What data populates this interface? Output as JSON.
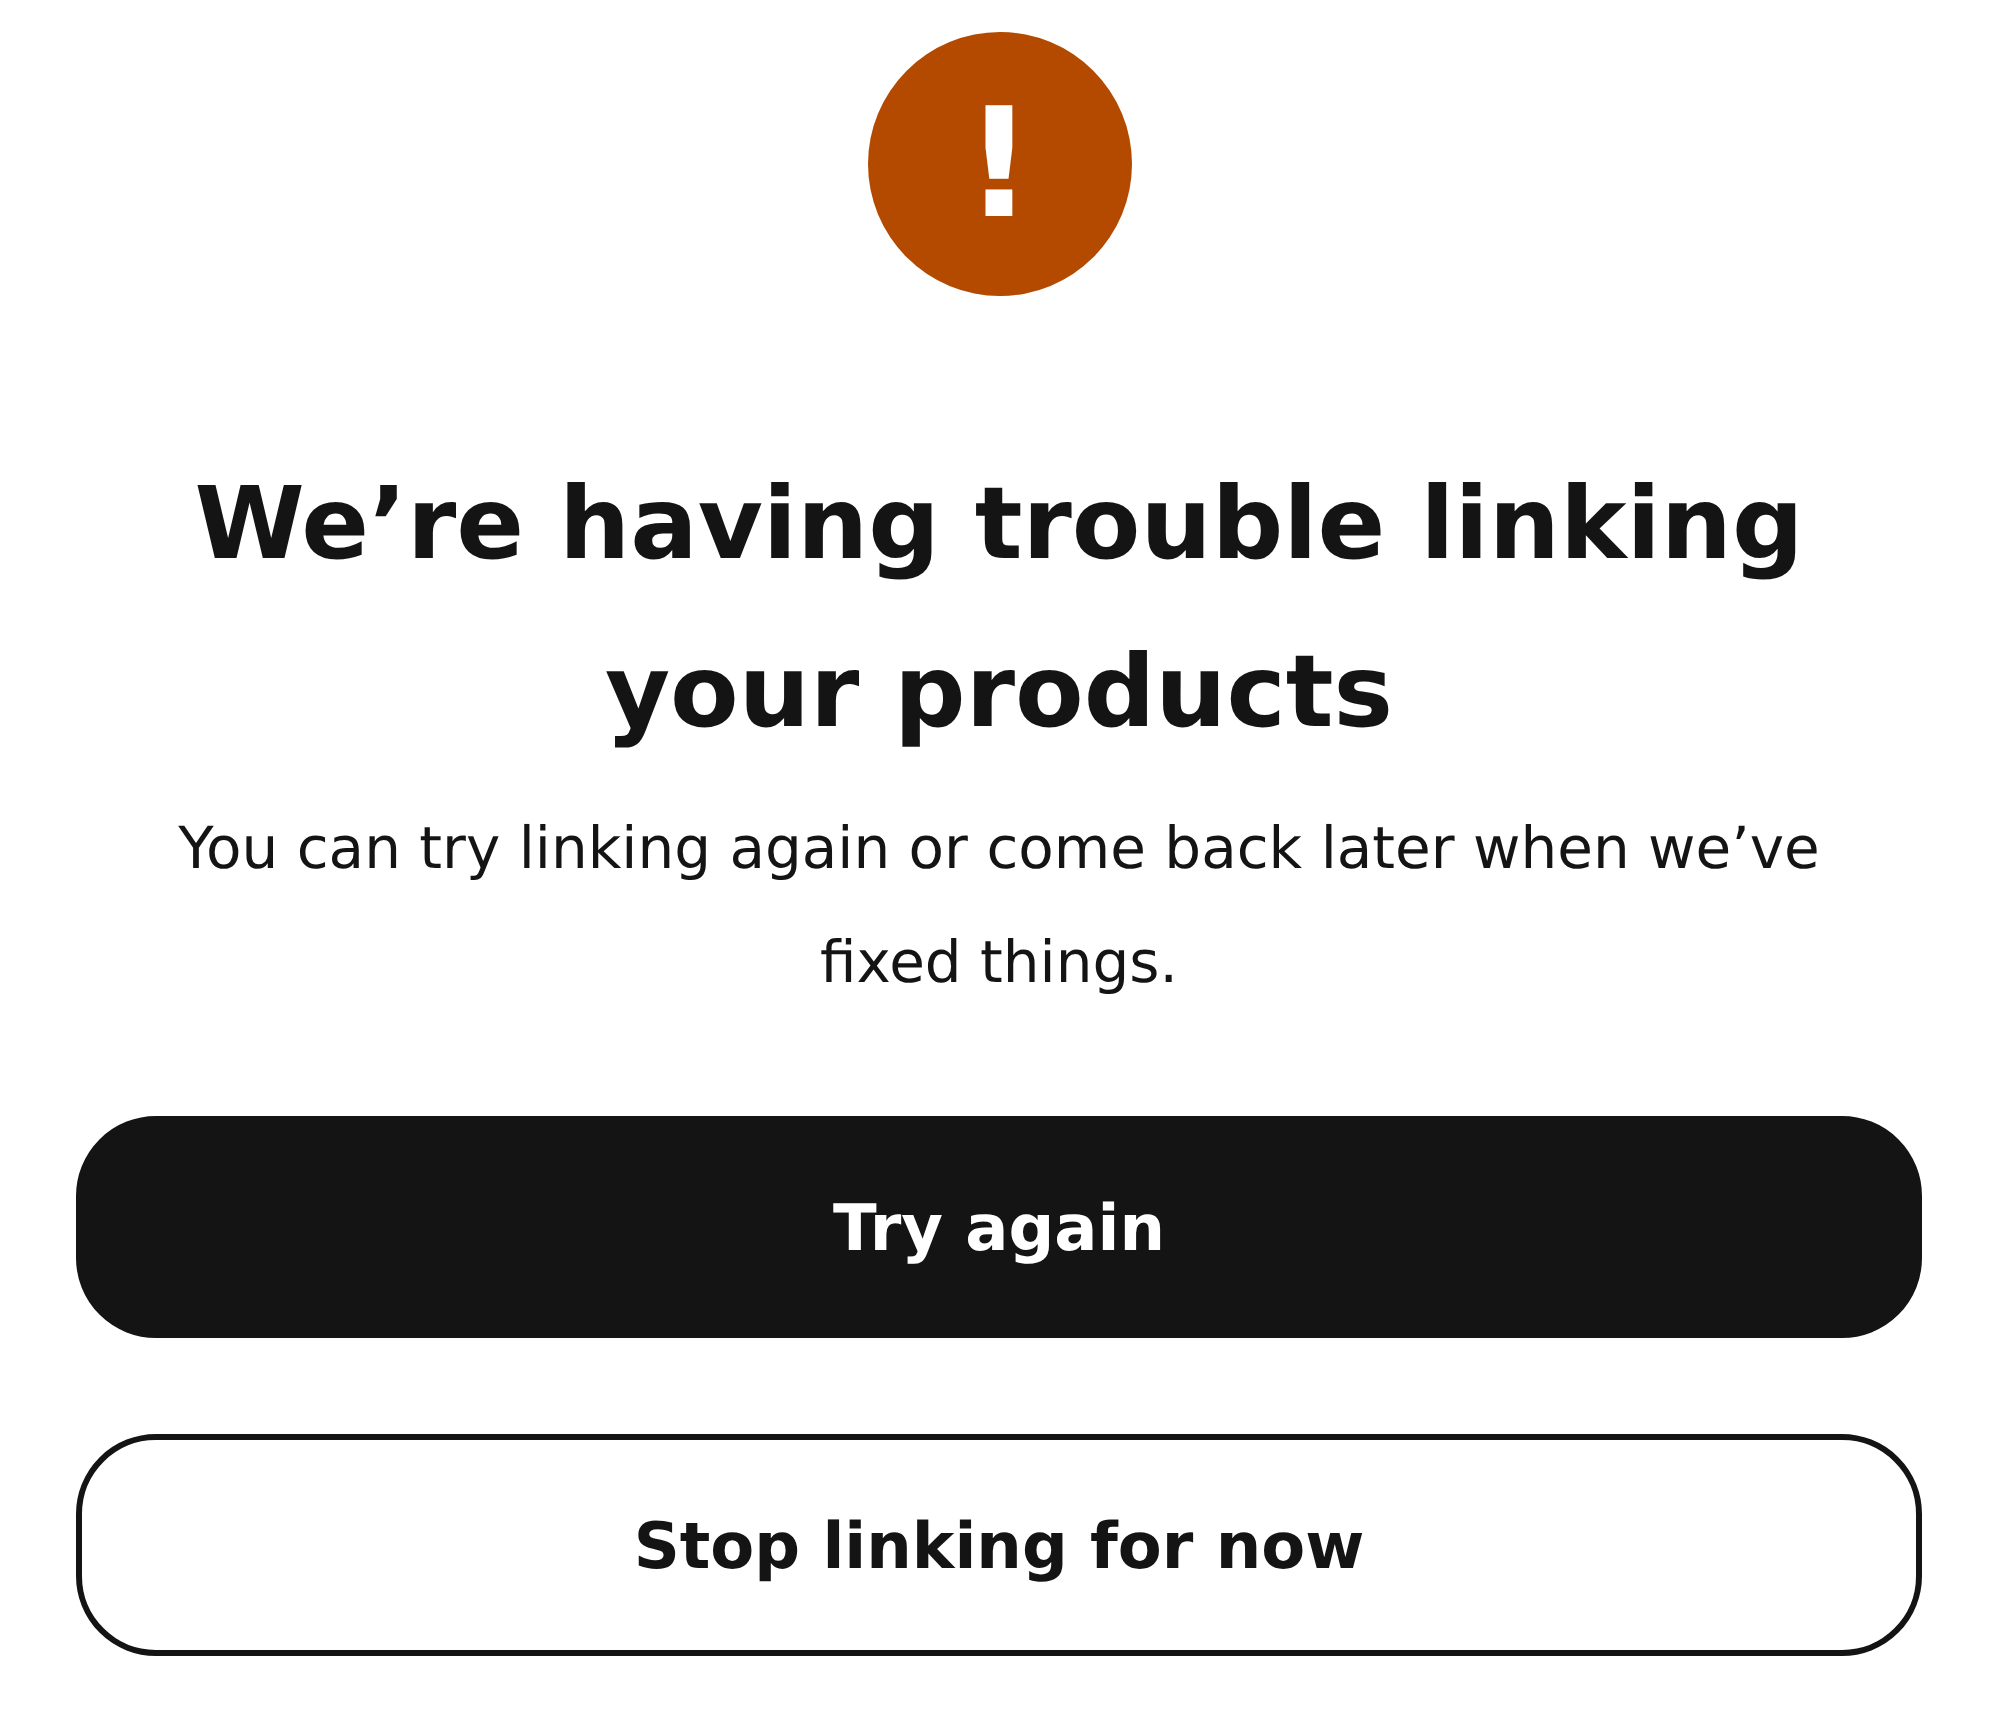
{
  "alert": {
    "icon_text": "!"
  },
  "title": "We’re having trouble linking your products",
  "message": "You can try linking again or come back later when we’ve fixed things.",
  "buttons": [
    {
      "label": "Try again",
      "kind": "primary"
    },
    {
      "label": "Stop linking for now",
      "kind": "secondary"
    }
  ]
}
